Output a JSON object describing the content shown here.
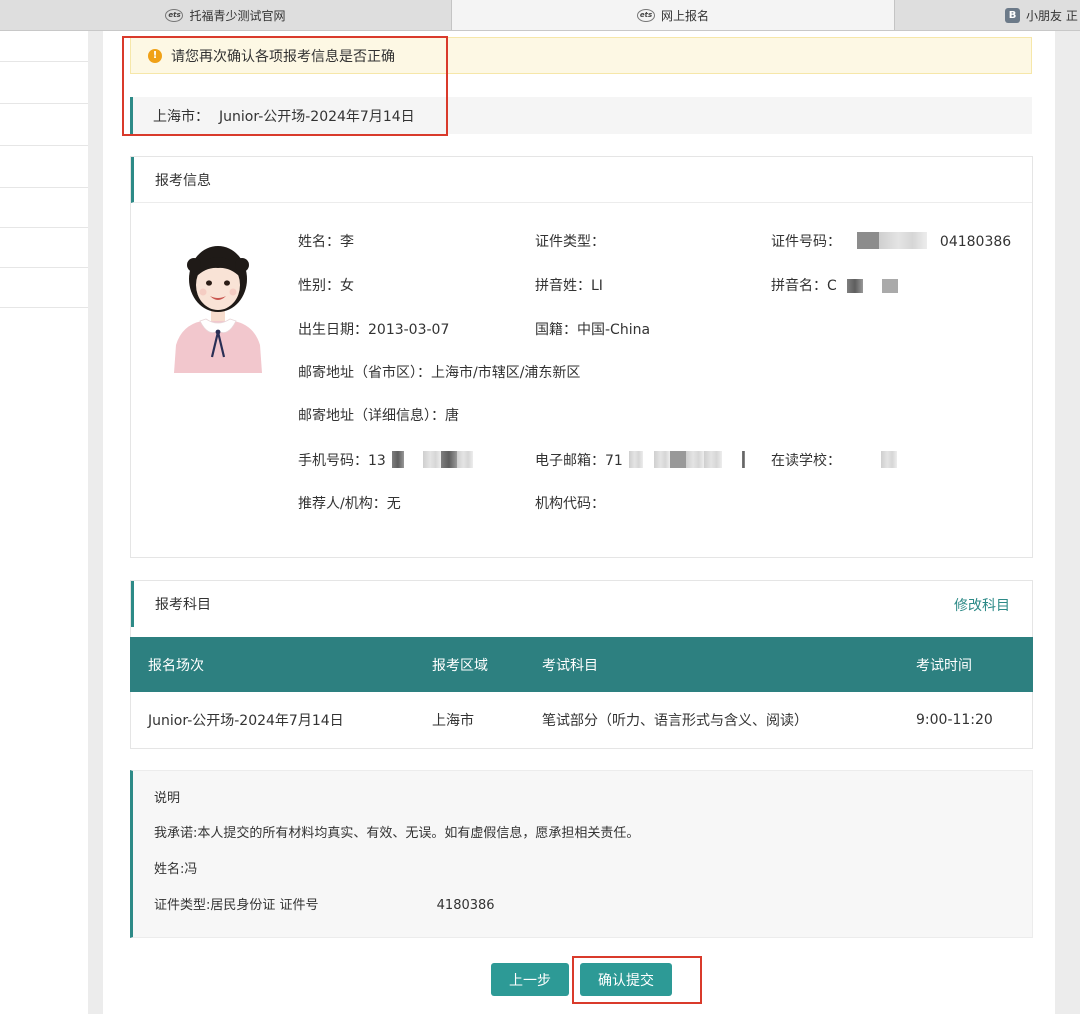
{
  "browser": {
    "tabs": [
      {
        "label": "托福青少测试官网",
        "icon": "ets-logo-icon"
      },
      {
        "label": "网上报名",
        "icon": "ets-logo-icon"
      },
      {
        "label": "小朋友 正",
        "icon": "b-logo-icon"
      }
    ],
    "ets_logo_text": "ets",
    "b_logo_text": "B"
  },
  "alert": {
    "icon": "!",
    "text": "请您再次确认各项报考信息是否正确"
  },
  "session": {
    "city": "上海市：",
    "name": "Junior-公开场-2024年7月14日"
  },
  "info": {
    "title": "报考信息",
    "name_label": "姓名：",
    "name_value": "李",
    "id_type_label": "证件类型：",
    "id_type_value": "",
    "id_no_label": "证件号码：",
    "id_no_suffix": "04180386",
    "gender_label": "性别：",
    "gender_value": "女",
    "pinyin_last_label": "拼音姓：",
    "pinyin_last_value": "LI",
    "pinyin_first_label": "拼音名：",
    "pinyin_first_value": "C",
    "dob_label": "出生日期：",
    "dob_value": "2013-03-07",
    "nationality_label": "国籍：",
    "nationality_value": "中国-China",
    "addr_region_label": "邮寄地址（省市区）：",
    "addr_region_value": "上海市/市辖区/浦东新区",
    "addr_detail_label": "邮寄地址（详细信息）：",
    "addr_detail_value": "唐",
    "phone_label": "手机号码：",
    "phone_value": "13",
    "email_label": "电子邮箱：",
    "email_value": "71",
    "school_label": "在读学校：",
    "school_value": "",
    "referrer_label": "推荐人/机构：",
    "referrer_value": "无",
    "org_code_label": "机构代码：",
    "org_code_value": ""
  },
  "subjects": {
    "title": "报考科目",
    "edit_link": "修改科目",
    "columns": [
      "报名场次",
      "报考区域",
      "考试科目",
      "考试时间"
    ],
    "rows": [
      [
        "Junior-公开场-2024年7月14日",
        "上海市",
        "笔试部分（听力、语言形式与含义、阅读）",
        "9:00-11:20"
      ]
    ]
  },
  "notes": {
    "title": "说明",
    "promise": "我承诺:本人提交的所有材料均真实、有效、无误。如有虚假信息，愿承担相关责任。",
    "name_line": "姓名:冯",
    "id_line": "证件类型:居民身份证 证件号",
    "id_suffix": "4180386"
  },
  "buttons": {
    "prev": "上一步",
    "submit": "确认提交"
  },
  "colors": {
    "accent": "#2d8a87",
    "table_header": "#2d8080",
    "alert_bg": "#fdf8e4",
    "warning_icon": "#f0a116",
    "highlight_red": "#d93a2b"
  }
}
